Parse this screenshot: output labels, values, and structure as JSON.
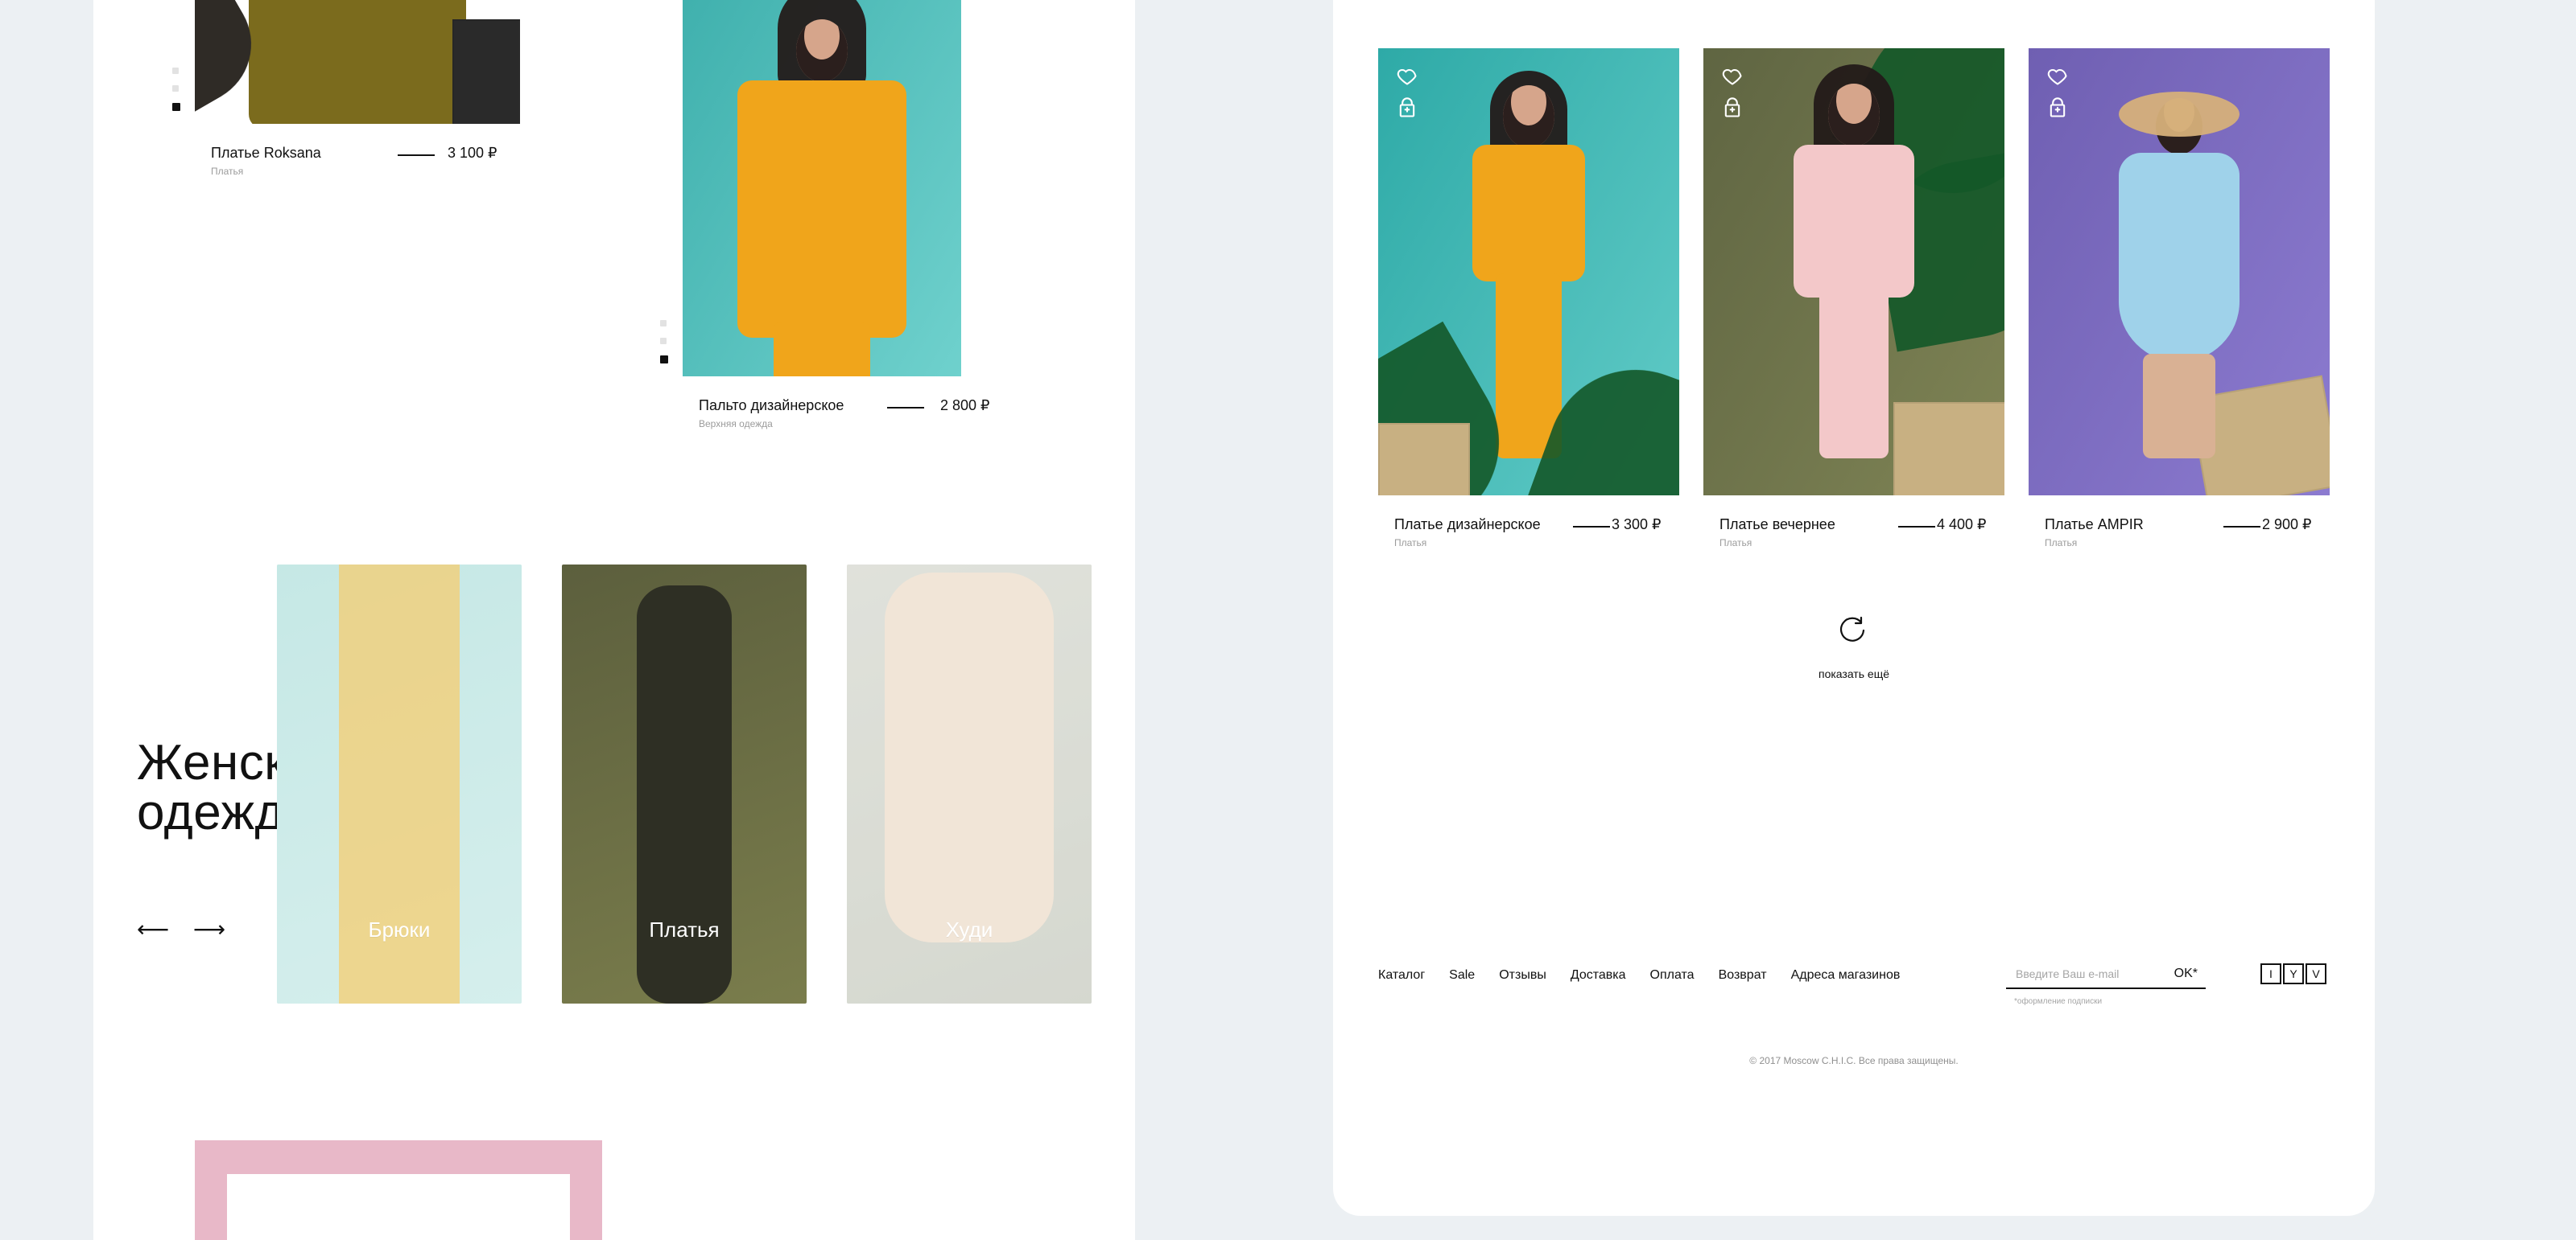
{
  "colors": {
    "page_bg": "#ecf0f3",
    "panel_bg": "#ffffff",
    "text": "#111111",
    "muted": "#9b9b9b",
    "teal": "#4fb9b7",
    "mustard": "#f2b21d",
    "olive": "#6a6a44",
    "pink": "#f5c5c6",
    "purple": "#7d6bbd",
    "promo_pink": "#e8b8c8"
  },
  "left": {
    "products": [
      {
        "name": "Платье Roksana",
        "category": "Платья",
        "price": "3 100 ₽"
      },
      {
        "name": "Пальто дизайнерское",
        "category": "Верхняя одежда",
        "price": "2 800 ₽"
      }
    ],
    "categories_block": {
      "title": "Женская\nодежда",
      "arrow_prev": "⟵",
      "arrow_next": "⟶",
      "items": [
        {
          "label": "Брюки"
        },
        {
          "label": "Платья"
        },
        {
          "label": "Худи"
        }
      ]
    }
  },
  "right": {
    "products": [
      {
        "name": "Платье дизайнерское",
        "category": "Платья",
        "price": "3 300 ₽"
      },
      {
        "name": "Платье вечернее",
        "category": "Платья",
        "price": "4 400 ₽"
      },
      {
        "name": "Платье AMPIR",
        "category": "Платья",
        "price": "2 900 ₽"
      }
    ],
    "show_more_label": "показать ещё",
    "footer": {
      "nav": [
        "Каталог",
        "Sale",
        "Отзывы",
        "Доставка",
        "Оплата",
        "Возврат",
        "Адреса магазинов"
      ],
      "newsletter": {
        "placeholder": "Введите Ваш e-mail",
        "ok": "OK*",
        "note": "*оформление подписки"
      },
      "socials": [
        "I",
        "Y",
        "V"
      ],
      "copyright": "© 2017 Moscow C.H.I.C. Все права защищены."
    }
  },
  "icons": {
    "favorite": "heart-icon",
    "cart": "shopping-bag-icon",
    "refresh": "refresh-icon"
  }
}
